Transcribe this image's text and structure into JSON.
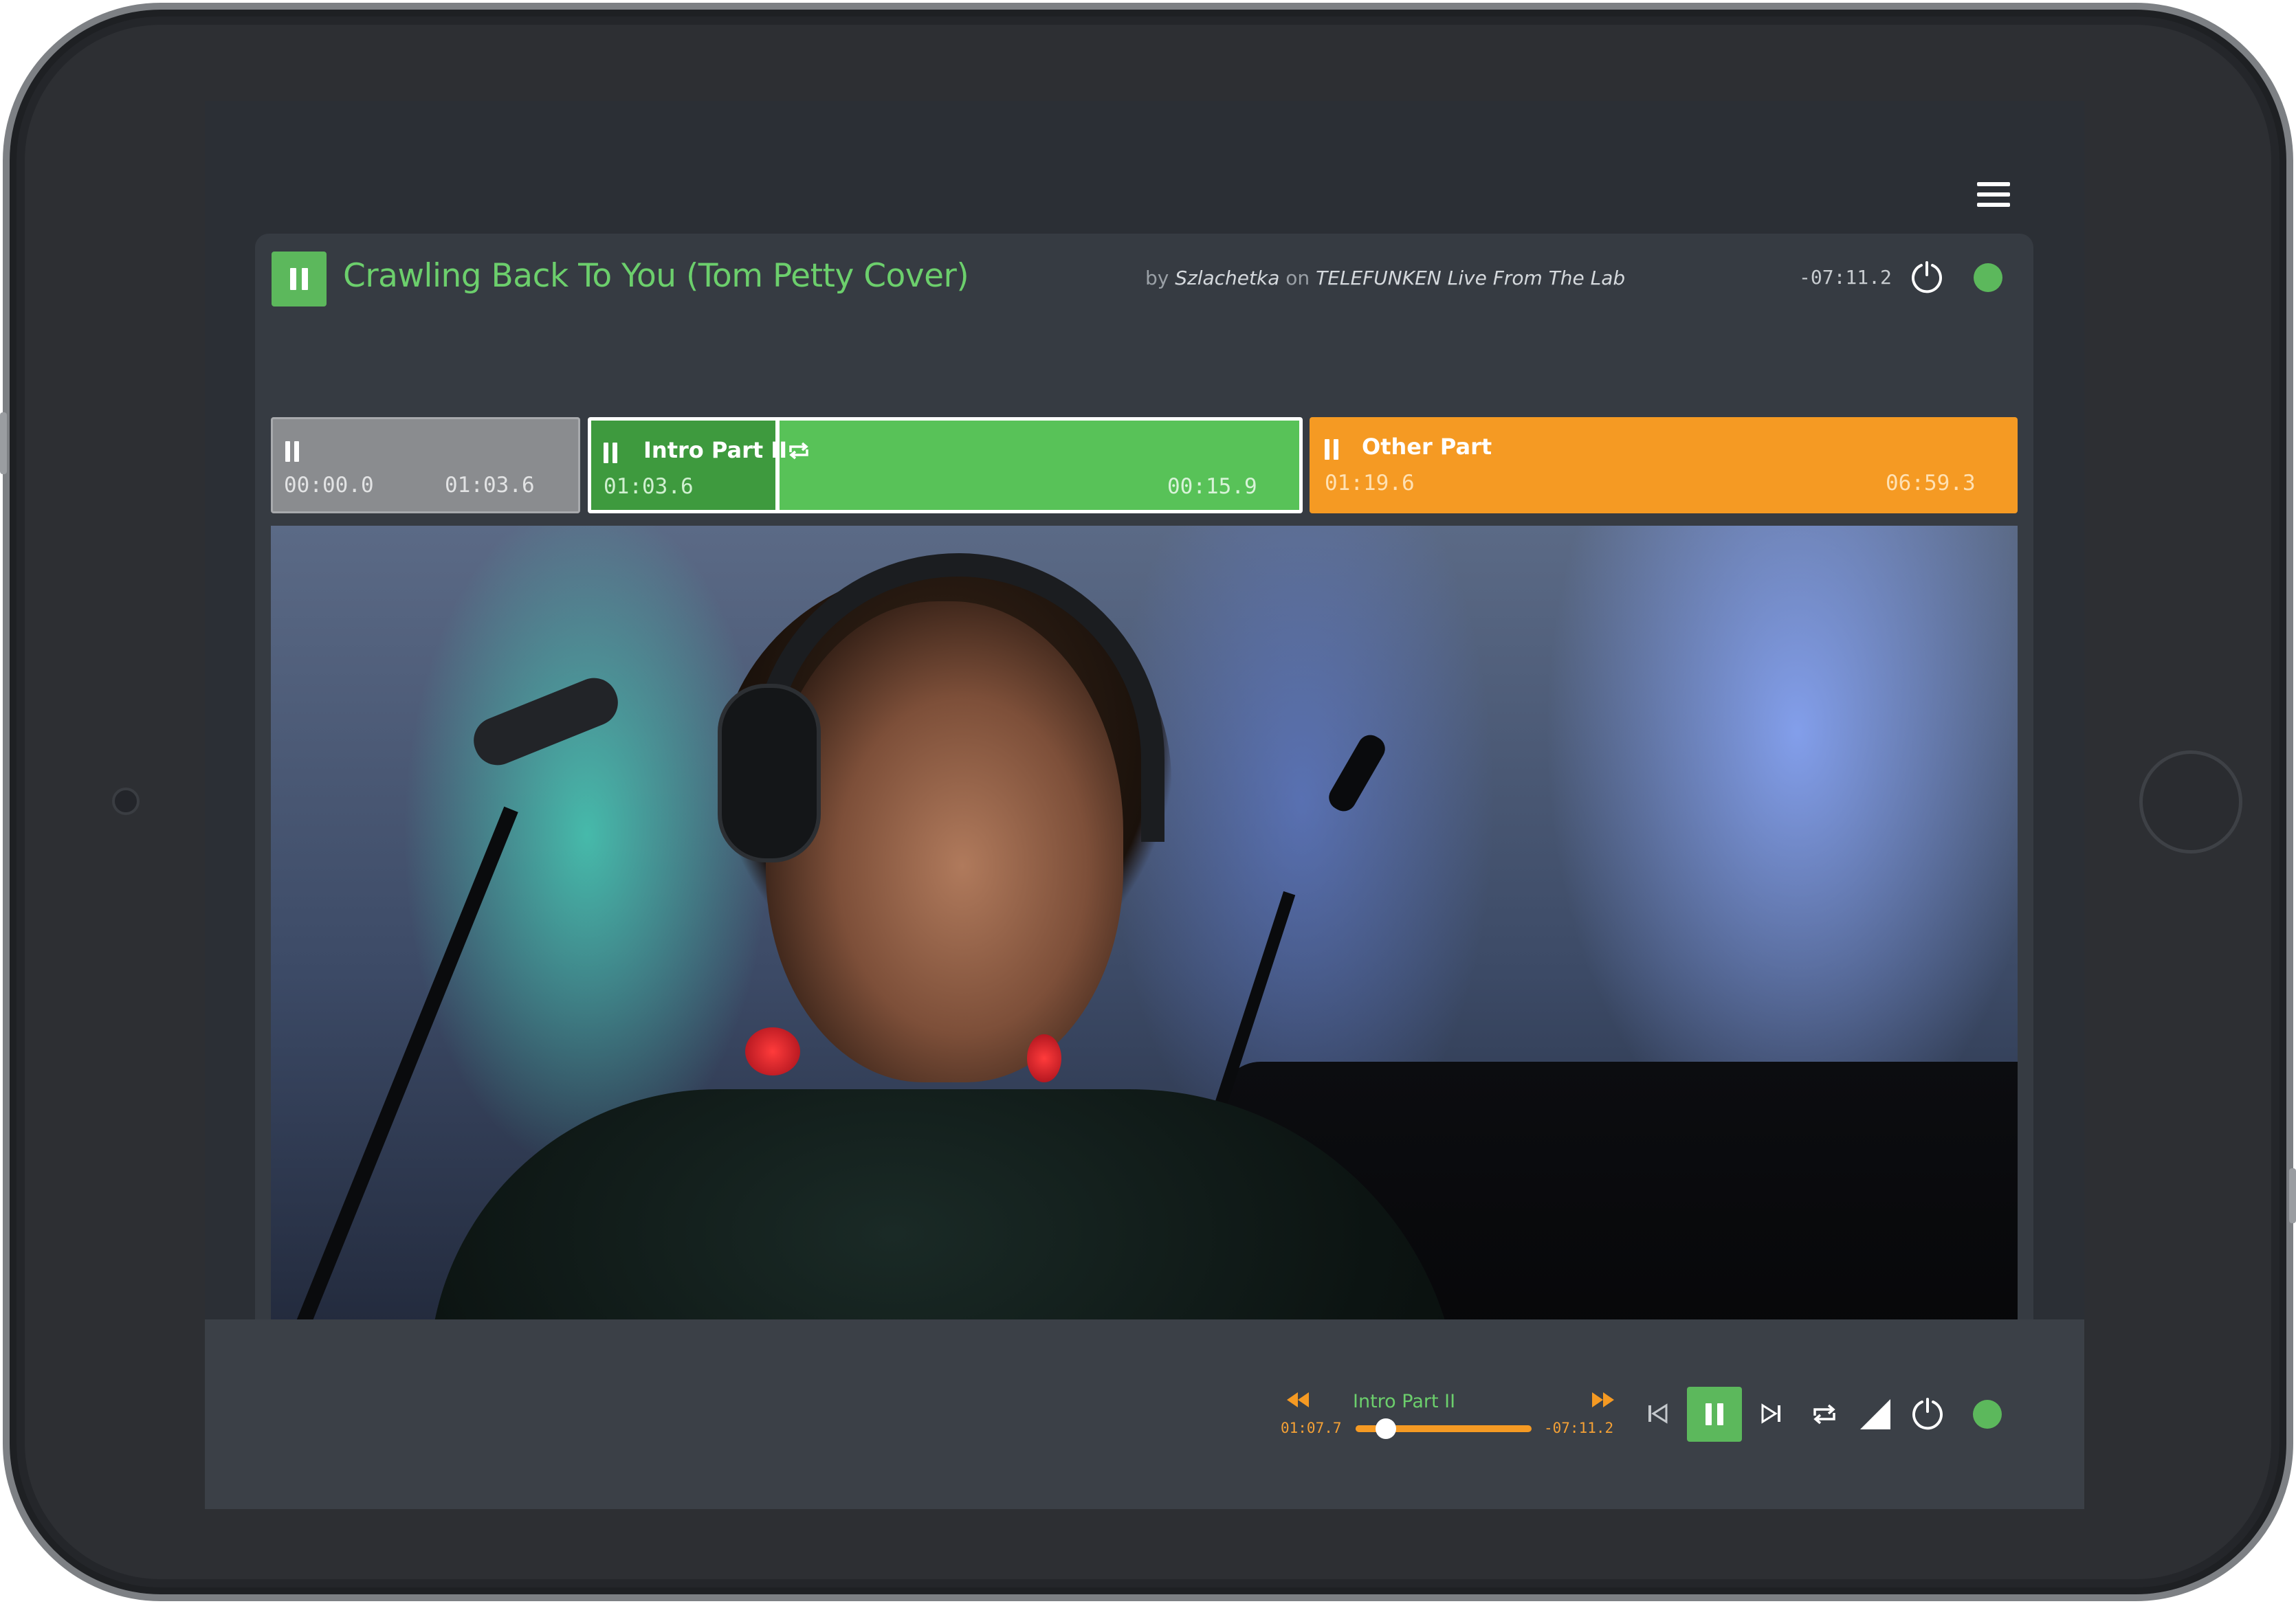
{
  "track": {
    "title": "Crawling Back To You (Tom Petty Cover)",
    "by_prefix": "by",
    "artist": "Szlachetka",
    "on_prefix": "on",
    "album": "TELEFUNKEN Live From The Lab",
    "remaining": "-07:11.2"
  },
  "segments": [
    {
      "name": "",
      "start": "00:00.0",
      "duration": "01:03.6",
      "color": "#8a8c8f",
      "state": "inactive"
    },
    {
      "name": "Intro Part II",
      "start": "01:03.6",
      "duration": "00:15.9",
      "color": "#58c258",
      "state": "playing",
      "looping": true,
      "progress": 0.26
    },
    {
      "name": "Other Part",
      "start": "01:19.6",
      "duration": "06:59.3",
      "color": "#f59a23",
      "state": "queued"
    }
  ],
  "controls": {
    "current_segment": "Intro Part II",
    "elapsed": "01:07.7",
    "remaining": "-07:11.2",
    "progress": 0.17
  },
  "icons": {
    "menu": "hamburger-menu-icon",
    "pause": "pause-icon",
    "loop": "loop-icon",
    "power": "power-icon",
    "rewind": "rewind-icon",
    "fast_forward": "fast-forward-icon",
    "skip_back": "skip-back-icon",
    "skip_forward": "skip-forward-icon",
    "repeat": "repeat-icon",
    "volume": "volume-icon"
  },
  "colors": {
    "accent_green": "#5cb85c",
    "accent_orange": "#f59a23",
    "background": "#2b2f35"
  }
}
